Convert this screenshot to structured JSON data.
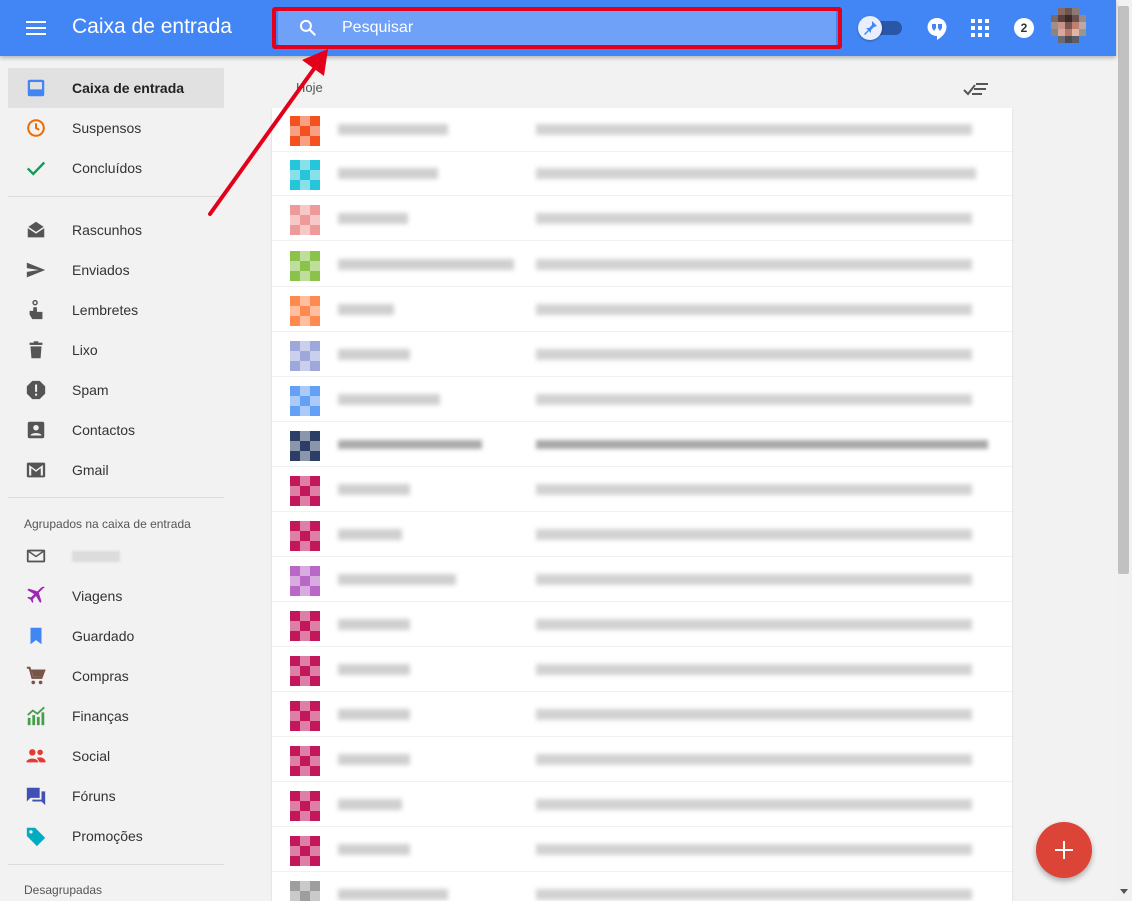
{
  "header": {
    "title": "Caixa de entrada",
    "search_placeholder": "Pesquisar",
    "notification_count": "2",
    "colors": {
      "bar": "#4285f4",
      "search_bg": "#6ea1f7",
      "highlight": "#e3001b"
    }
  },
  "sidebar": {
    "main_items": [
      {
        "label": "Caixa de entrada",
        "icon": "inbox-icon",
        "active": true
      },
      {
        "label": "Suspensos",
        "icon": "clock-icon"
      },
      {
        "label": "Concluídos",
        "icon": "check-icon"
      }
    ],
    "system_items": [
      {
        "label": "Rascunhos",
        "icon": "drafts-icon"
      },
      {
        "label": "Enviados",
        "icon": "send-icon"
      },
      {
        "label": "Lembretes",
        "icon": "reminder-icon"
      },
      {
        "label": "Lixo",
        "icon": "trash-icon"
      },
      {
        "label": "Spam",
        "icon": "spam-icon"
      },
      {
        "label": "Contactos",
        "icon": "contacts-icon"
      },
      {
        "label": "Gmail",
        "icon": "gmail-icon"
      }
    ],
    "bundled_section_label": "Agrupados na caixa de entrada",
    "bundled_items": [
      {
        "label": "",
        "icon": "mail-icon"
      },
      {
        "label": "Viagens",
        "icon": "plane-icon"
      },
      {
        "label": "Guardado",
        "icon": "bookmark-icon"
      },
      {
        "label": "Compras",
        "icon": "cart-icon"
      },
      {
        "label": "Finanças",
        "icon": "finance-icon"
      },
      {
        "label": "Social",
        "icon": "people-icon"
      },
      {
        "label": "Fóruns",
        "icon": "forum-icon"
      },
      {
        "label": "Promoções",
        "icon": "tag-icon"
      }
    ],
    "unbundled_section_label": "Desagrupadas"
  },
  "main": {
    "date_group": "Hoje",
    "emails": [
      {
        "color": "#f4511e"
      },
      {
        "color": "#26c6da"
      },
      {
        "color": "#ef9a9a"
      },
      {
        "color": "#8bc34a"
      },
      {
        "color": "#ff8a50"
      },
      {
        "color": "#9fa8da"
      },
      {
        "color": "#64a0f5"
      },
      {
        "color": "#2c3e66"
      },
      {
        "color": "#c2185b"
      },
      {
        "color": "#c2185b"
      },
      {
        "color": "#ba68c8"
      },
      {
        "color": "#c2185b"
      },
      {
        "color": "#c2185b"
      },
      {
        "color": "#c2185b"
      },
      {
        "color": "#c2185b"
      },
      {
        "color": "#c2185b"
      },
      {
        "color": "#c2185b"
      },
      {
        "color": "#9e9e9e"
      }
    ]
  },
  "fab": {
    "icon": "plus-icon",
    "color": "#db4437"
  }
}
